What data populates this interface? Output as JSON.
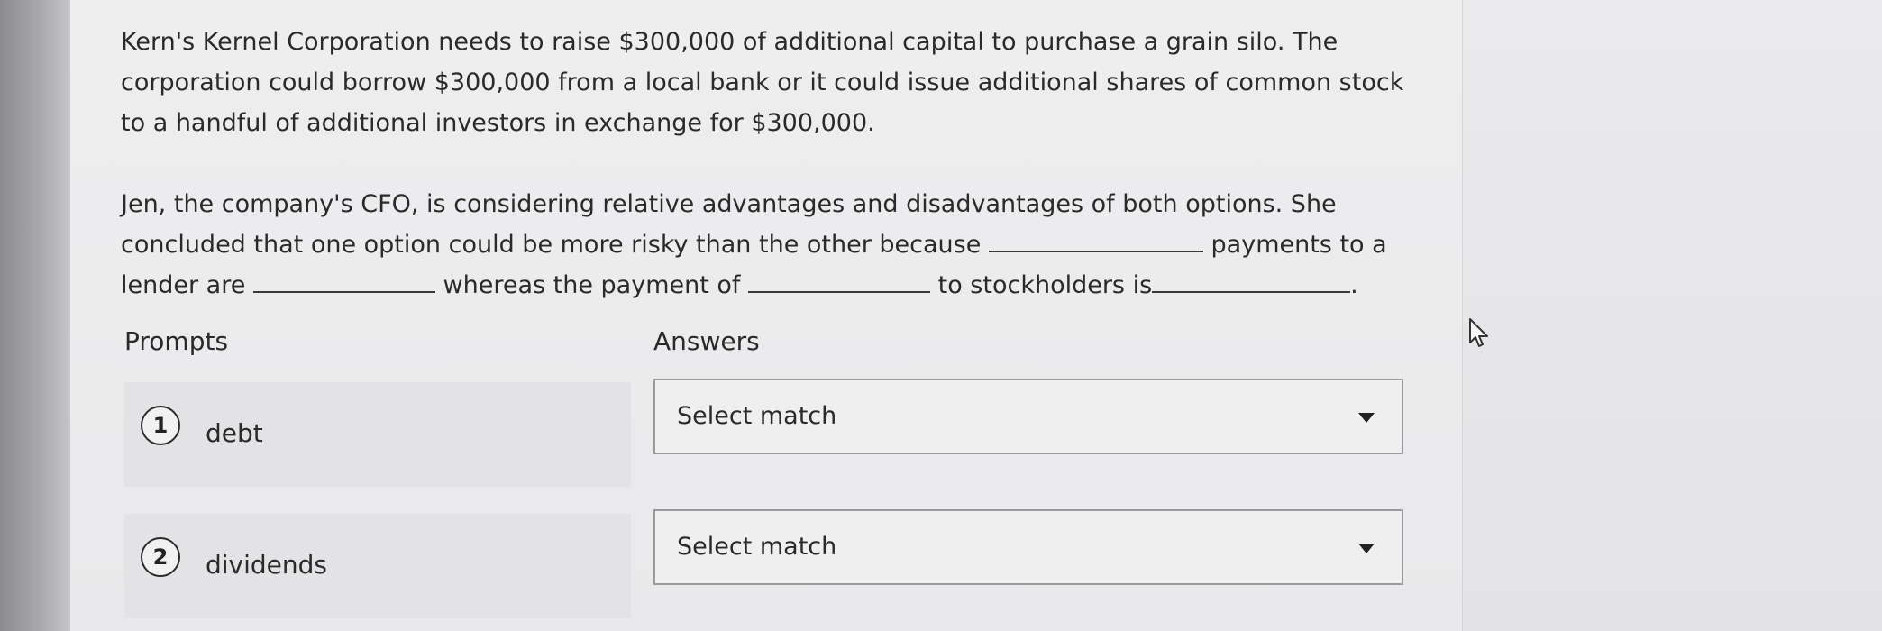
{
  "question": {
    "paragraph1": "Kern's Kernel Corporation needs to raise $300,000 of additional capital to purchase a grain silo. The corporation could borrow $300,000 from a local bank or it could issue additional shares of common stock to a handful of additional investors in exchange for $300,000.",
    "paragraph2_part1": "Jen, the company's CFO, is considering relative advantages and disadvantages of both options. She concluded that one option could be more risky than the other because",
    "paragraph2_part2": "payments to a lender are",
    "paragraph2_part3": "whereas the payment of",
    "paragraph2_part4": "to stockholders is",
    "paragraph2_end": "."
  },
  "headings": {
    "prompts": "Prompts",
    "answers": "Answers"
  },
  "prompts": [
    {
      "number": "1",
      "label": "debt"
    },
    {
      "number": "2",
      "label": "dividends"
    }
  ],
  "answers": [
    {
      "value": "Select match",
      "icon": "caret-down-icon"
    },
    {
      "value": "Select match",
      "icon": "caret-down-icon"
    }
  ],
  "cursor": {
    "icon": "mouse-pointer-icon"
  }
}
